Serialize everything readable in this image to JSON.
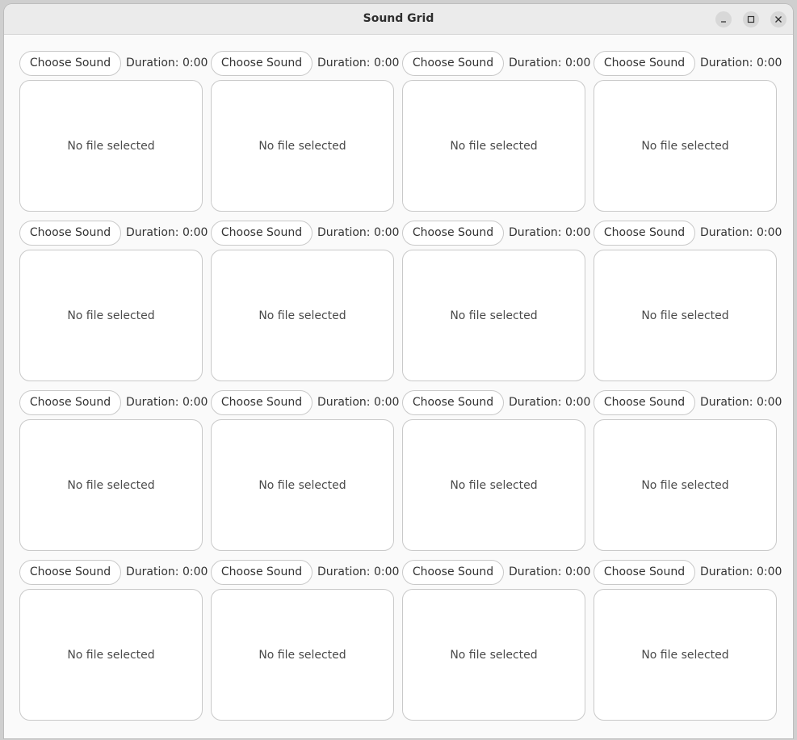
{
  "window": {
    "title": "Sound Grid",
    "controls": [
      "minimize-icon",
      "maximize-icon",
      "close-icon"
    ]
  },
  "grid": {
    "cells": [
      {
        "button_label": "Choose Sound",
        "duration": "Duration: 0:00",
        "status": "No file selected"
      },
      {
        "button_label": "Choose Sound",
        "duration": "Duration: 0:00",
        "status": "No file selected"
      },
      {
        "button_label": "Choose Sound",
        "duration": "Duration: 0:00",
        "status": "No file selected"
      },
      {
        "button_label": "Choose Sound",
        "duration": "Duration: 0:00",
        "status": "No file selected"
      },
      {
        "button_label": "Choose Sound",
        "duration": "Duration: 0:00",
        "status": "No file selected"
      },
      {
        "button_label": "Choose Sound",
        "duration": "Duration: 0:00",
        "status": "No file selected"
      },
      {
        "button_label": "Choose Sound",
        "duration": "Duration: 0:00",
        "status": "No file selected"
      },
      {
        "button_label": "Choose Sound",
        "duration": "Duration: 0:00",
        "status": "No file selected"
      },
      {
        "button_label": "Choose Sound",
        "duration": "Duration: 0:00",
        "status": "No file selected"
      },
      {
        "button_label": "Choose Sound",
        "duration": "Duration: 0:00",
        "status": "No file selected"
      },
      {
        "button_label": "Choose Sound",
        "duration": "Duration: 0:00",
        "status": "No file selected"
      },
      {
        "button_label": "Choose Sound",
        "duration": "Duration: 0:00",
        "status": "No file selected"
      },
      {
        "button_label": "Choose Sound",
        "duration": "Duration: 0:00",
        "status": "No file selected"
      },
      {
        "button_label": "Choose Sound",
        "duration": "Duration: 0:00",
        "status": "No file selected"
      },
      {
        "button_label": "Choose Sound",
        "duration": "Duration: 0:00",
        "status": "No file selected"
      },
      {
        "button_label": "Choose Sound",
        "duration": "Duration: 0:00",
        "status": "No file selected"
      }
    ]
  }
}
